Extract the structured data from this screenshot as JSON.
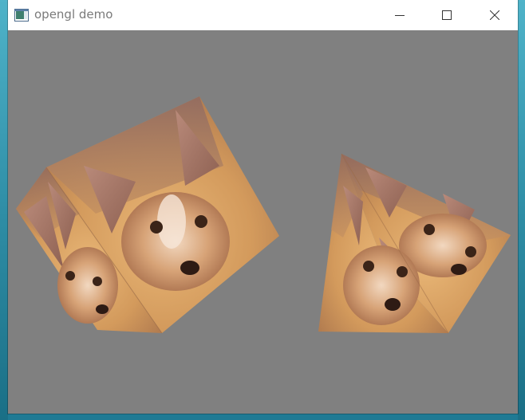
{
  "window": {
    "title": "opengl demo",
    "app_icon": "opengl-app-icon",
    "controls": {
      "minimize_icon": "minimize-icon",
      "maximize_icon": "maximize-icon",
      "close_icon": "close-icon"
    }
  },
  "canvas": {
    "background_color": "#808080",
    "objects": [
      "textured-cube-left",
      "textured-cube-right"
    ],
    "texture": "puppy-photo"
  },
  "colors": {
    "titlebar": "#ffffff",
    "title_text": "#7a7a7a",
    "canvas_bg": "#808080",
    "desktop": "#2c8fa8"
  }
}
